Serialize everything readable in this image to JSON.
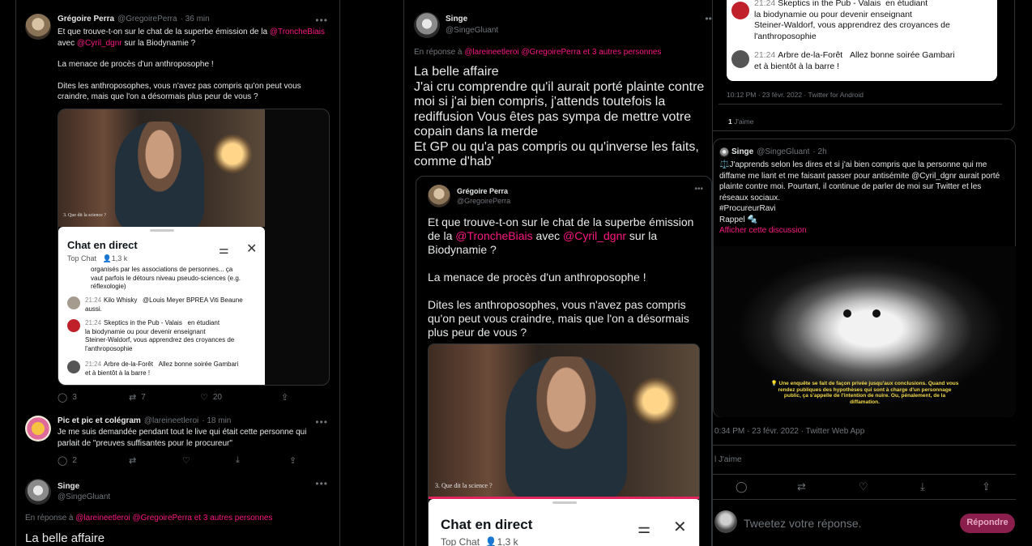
{
  "col1": {
    "tweet1": {
      "name": "Grégoire Perra",
      "handle": "@GregoirePerra",
      "time": "· 36 min",
      "line1_a": "Et que trouve-t-on sur le chat de la superbe émission de la ",
      "line1_mention": "@TroncheBiais",
      "line2_a": "avec ",
      "line2_mention": "@Cyril_dgnr",
      "line2_b": " sur la Biodynamie ?",
      "para2": "La menace de procès d'un anthroposophe !",
      "para3_l1": "Dites les anthroposophes, vous n'avez pas compris qu'on peut vous",
      "para3_l2": "craindre, mais que l'on a désormais plus peur de vous ?",
      "video_caption": "3. Que dit la science ?",
      "replies": "3",
      "retweets": "7",
      "likes": "20"
    },
    "chat": {
      "title": "Chat en direct",
      "sub_top": "Top Chat",
      "viewers": "1,3 k",
      "msg0_l1": "organisés par les associations de personnes... ça",
      "msg0_l2": "vaut parfois le détours niveau pseudo-sciences (e.g.",
      "msg0_l3": "réflexologie)",
      "msg1_time": "21:24",
      "msg1_author": "Kilo Whisky",
      "msg1_text": "@Louis Meyer BPREA Viti Beaune",
      "msg1_text2": "aussi.",
      "msg2_time": "21:24",
      "msg2_author": "Skeptics in the Pub - Valais",
      "msg2_text": "en étudiant",
      "msg2_l2": "la biodynamie ou pour devenir enseignant",
      "msg2_l3": "Steiner-Waldorf, vous apprendrez des croyances de",
      "msg2_l4": "l'anthroposophie",
      "msg3_time": "21:24",
      "msg3_author": "Arbre de-la-Forêt",
      "msg3_text": "Allez bonne soirée Gambari",
      "msg3_l2": "et à bientôt à la barre !"
    },
    "tweet2": {
      "name": "Pic et pic et colégram",
      "handle": "@lareineetleroi",
      "time": "· 18 min",
      "line1": "Je me suis demandée pendant tout le live qui était cette personne qui",
      "line2": "parlait de \"preuves suffisantes pour le procureur\"",
      "replies": "2"
    },
    "tweet3": {
      "name": "Singe",
      "handle": "@SingeGluant",
      "reply_prefix": "En réponse à ",
      "reply_mentions": "@lareineetleroi @GregoirePerra",
      "reply_suffix": " et 3 autres personnes",
      "text": "La belle affaire"
    }
  },
  "col2": {
    "name": "Singe",
    "handle": "@SingeGluant",
    "reply_prefix": "En réponse à ",
    "reply_mentions": "@lareineetleroi @GregoirePerra",
    "reply_suffix": " et 3 autres personnes",
    "l1": "La belle affaire",
    "l2": "J'ai cru comprendre qu'il aurait porté plainte contre",
    "l3": "moi si j'ai bien compris, j'attends toutefois la",
    "l4": "rediffusion Vous êtes pas sympa de mettre votre",
    "l5": "copain dans la merde",
    "l6": "Et GP ou qu'a pas compris ou qu'inverse les faits,",
    "l7": "comme d'hab'",
    "quote": {
      "name": "Grégoire Perra",
      "handle": "@GregoirePerra",
      "q1": "Et que trouve-t-on sur le chat de la superbe émission",
      "q2_a": "de la ",
      "q2_m1": "@TroncheBiais",
      "q2_b": " avec ",
      "q2_m2": "@Cyril_dgnr",
      "q2_c": " sur la",
      "q3": "Biodynamie ?",
      "q4": "La menace de procès d'un anthroposophe !",
      "q5": "Dites les anthroposophes, vous n'avez pas compris",
      "q6": "qu'on peut vous craindre, mais que l'on a désormais",
      "q7": "plus peur de vous ?",
      "video_caption": "3. Que dit la science ?",
      "chat_title": "Chat en direct",
      "chat_sub": "Top Chat",
      "chat_viewers": "1,3 k"
    }
  },
  "col3": {
    "top_chat": {
      "m1_time": "21:24",
      "m1_author": "Skeptics in the Pub - Valais",
      "m1_text": "en étudiant",
      "m1_l2": "la biodynamie ou pour devenir enseignant",
      "m1_l3": "Steiner-Waldorf, vous apprendrez des croyances de",
      "m1_l4": "l'anthroposophie",
      "m2_time": "21:24",
      "m2_author": "Arbre de-la-Forêt",
      "m2_text": "Allez bonne soirée Gambari",
      "m2_l2": "et à bientôt à la barre !"
    },
    "meta1": "10:12 PM · 23 févr. 2022 · Twitter for Android",
    "likes1_num": "1",
    "likes1_label": " J'aime",
    "tweet": {
      "name": "Singe",
      "handle": "@SingeGluant",
      "time": "· 2h",
      "l1": "⚖️J'apprends selon les dires et si j'ai bien compris que la personne qui me",
      "l2": "diffame me liant et me faisant passer pour antisémite @Cyril_dgnr aurait porté",
      "l3": "plainte contre moi. Pourtant, il continue de parler de moi sur Twitter et les",
      "l4": "réseaux sociaux.",
      "l5": "#ProcureurRavi",
      "l6": "Rappel 🔩",
      "show_thread": "Afficher cette discussion",
      "subtitle_l1": "💡 Une enquête se fait de façon privée jusqu'aux conclusions. Quand vous",
      "subtitle_l2": "rendez publiques des hypothèses qui sont à charge d'un personnage",
      "subtitle_l3": "public, ça s'appelle de l'intention de nuire. Ou, pénalement, de la",
      "subtitle_l4": "diffamation."
    },
    "meta2": "0:34 PM · 23 févr. 2022 · Twitter Web App",
    "likes2_label": "l J'aime",
    "reply_placeholder": "Tweetez votre réponse.",
    "reply_button": "Répondre"
  }
}
